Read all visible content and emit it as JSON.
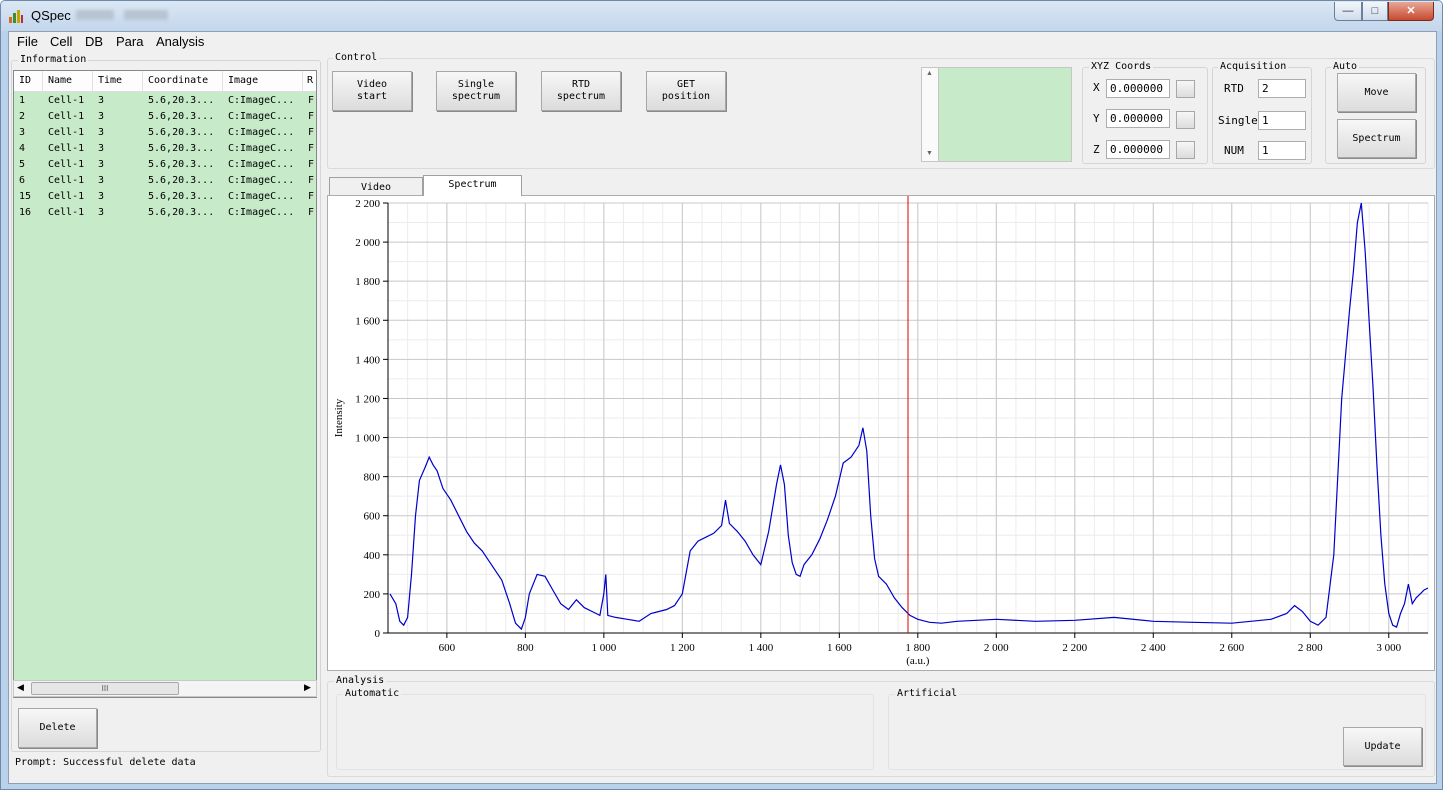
{
  "window": {
    "title": "QSpec"
  },
  "menu": [
    "File",
    "Cell",
    "DB",
    "Para",
    "Analysis"
  ],
  "information": {
    "label": "Information",
    "columns": [
      "ID",
      "Name",
      "Time",
      "Coordinate",
      "Image",
      "R"
    ],
    "rows": [
      [
        "1",
        "Cell-1",
        "3",
        "5.6,20.3...",
        "C:ImageC...",
        "F"
      ],
      [
        "2",
        "Cell-1",
        "3",
        "5.6,20.3...",
        "C:ImageC...",
        "F"
      ],
      [
        "3",
        "Cell-1",
        "3",
        "5.6,20.3...",
        "C:ImageC...",
        "F"
      ],
      [
        "4",
        "Cell-1",
        "3",
        "5.6,20.3...",
        "C:ImageC...",
        "F"
      ],
      [
        "5",
        "Cell-1",
        "3",
        "5.6,20.3...",
        "C:ImageC...",
        "F"
      ],
      [
        "6",
        "Cell-1",
        "3",
        "5.6,20.3...",
        "C:ImageC...",
        "F"
      ],
      [
        "15",
        "Cell-1",
        "3",
        "5.6,20.3...",
        "C:ImageC...",
        "F"
      ],
      [
        "16",
        "Cell-1",
        "3",
        "5.6,20.3...",
        "C:ImageC...",
        "F"
      ]
    ],
    "scroll_thumb": "III",
    "delete_label": "Delete",
    "prompt": "Prompt: Successful delete data"
  },
  "control": {
    "label": "Control",
    "video_start": "Video\nstart",
    "single_spectrum": "Single\nspectrum",
    "rtd_spectrum": "RTD\nspectrum",
    "get_position": "GET\nposition"
  },
  "xyz": {
    "label": "XYZ Coords",
    "x_label": "X",
    "x": "0.000000",
    "y_label": "Y",
    "y": "0.000000",
    "z_label": "Z",
    "z": "0.000000"
  },
  "acquisition": {
    "label": "Acquisition",
    "rtd_label": "RTD",
    "rtd": "2",
    "single_label": "Single",
    "single": "1",
    "num_label": "NUM",
    "num": "1"
  },
  "auto": {
    "label": "Auto",
    "move": "Move",
    "spectrum": "Spectrum"
  },
  "tabs": {
    "video": "Video",
    "spectrum": "Spectrum"
  },
  "analysis": {
    "label": "Analysis",
    "automatic": "Automatic",
    "artificial": "Artificial",
    "update": "Update"
  },
  "colors": {
    "list_bg": "#c7ebc9",
    "line": "#0000cc",
    "marker": "#e00000"
  },
  "chart_data": {
    "type": "line",
    "ylabel": "Intensity",
    "xlabel": "(a.u.)",
    "xlim": [
      450,
      3100
    ],
    "ylim": [
      0,
      2200
    ],
    "xticks": [
      600,
      800,
      1000,
      1200,
      1400,
      1600,
      1800,
      2000,
      2200,
      2400,
      2600,
      2800,
      3000
    ],
    "xtick_labels": [
      "600",
      "800",
      "1 000",
      "1 200",
      "1 400",
      "1 600",
      "1 800",
      "2 000",
      "2 200",
      "2 400",
      "2 600",
      "2 800",
      "3 000"
    ],
    "yticks": [
      0,
      200,
      400,
      600,
      800,
      1000,
      1200,
      1400,
      1600,
      1800,
      2000,
      2200
    ],
    "ytick_labels": [
      "0",
      "200",
      "400",
      "600",
      "800",
      "1 000",
      "1 200",
      "1 400",
      "1 600",
      "1 800",
      "2 000",
      "2 200"
    ],
    "grid": true,
    "marker_x": 1775,
    "series": [
      {
        "x": [
          455,
          470,
          480,
          490,
          500,
          510,
          520,
          530,
          545,
          555,
          565,
          575,
          590,
          610,
          630,
          650,
          670,
          690,
          710,
          740,
          760,
          775,
          790,
          800,
          810,
          830,
          850,
          870,
          890,
          910,
          930,
          950,
          970,
          990,
          1000,
          1005,
          1010,
          1030,
          1060,
          1090,
          1120,
          1140,
          1160,
          1180,
          1200,
          1220,
          1240,
          1260,
          1280,
          1300,
          1310,
          1320,
          1340,
          1360,
          1380,
          1400,
          1420,
          1440,
          1450,
          1460,
          1470,
          1480,
          1490,
          1500,
          1510,
          1530,
          1550,
          1570,
          1590,
          1610,
          1630,
          1650,
          1660,
          1670,
          1680,
          1690,
          1700,
          1720,
          1740,
          1760,
          1780,
          1800,
          1830,
          1860,
          1900,
          2000,
          2100,
          2200,
          2300,
          2400,
          2500,
          2600,
          2700,
          2740,
          2760,
          2780,
          2800,
          2820,
          2840,
          2860,
          2880,
          2900,
          2910,
          2920,
          2930,
          2940,
          2950,
          2960,
          2970,
          2980,
          2990,
          3000,
          3010,
          3020,
          3030,
          3040,
          3050,
          3060,
          3070,
          3080,
          3090,
          3100
        ],
        "y": [
          200,
          150,
          60,
          40,
          80,
          300,
          600,
          780,
          850,
          900,
          860,
          830,
          740,
          680,
          600,
          520,
          460,
          420,
          360,
          270,
          150,
          50,
          20,
          80,
          200,
          300,
          290,
          220,
          150,
          120,
          170,
          130,
          110,
          90,
          200,
          300,
          90,
          80,
          70,
          60,
          100,
          110,
          120,
          140,
          200,
          420,
          470,
          490,
          510,
          550,
          680,
          560,
          520,
          470,
          400,
          350,
          520,
          760,
          860,
          760,
          500,
          360,
          300,
          290,
          350,
          400,
          480,
          580,
          700,
          870,
          900,
          960,
          1050,
          930,
          600,
          380,
          290,
          250,
          180,
          130,
          90,
          70,
          55,
          50,
          60,
          70,
          60,
          65,
          80,
          60,
          55,
          50,
          70,
          100,
          140,
          110,
          60,
          40,
          80,
          400,
          1200,
          1650,
          1850,
          2100,
          2200,
          1950,
          1600,
          1250,
          850,
          500,
          250,
          100,
          40,
          30,
          100,
          150,
          250,
          150,
          180,
          200,
          220,
          230
        ]
      }
    ]
  }
}
